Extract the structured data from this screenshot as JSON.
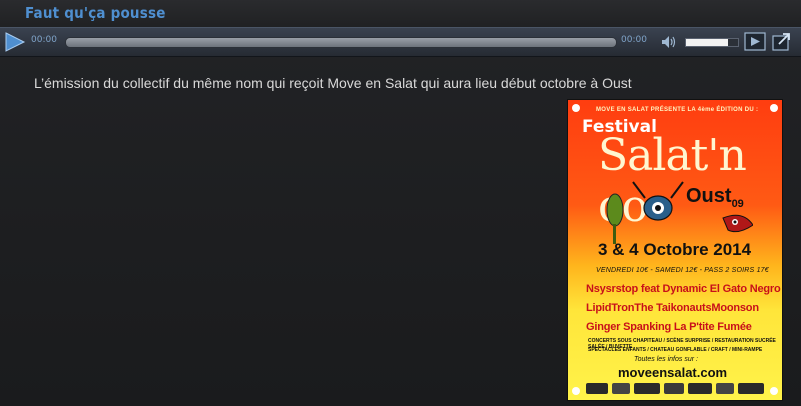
{
  "widget": {
    "title": "Faut qu'ça pousse"
  },
  "player": {
    "current_time": "00:00",
    "duration": "00:00",
    "progress": 0.0,
    "volume": 0.8,
    "icons": {
      "play": "play-icon",
      "volume": "speaker-icon",
      "popup": "popup-player-icon",
      "share": "share-export-icon"
    },
    "accent_color": "#4f8fd0"
  },
  "content": {
    "description": "L’émission du collectif du même nom qui reçoit Move en Salat qui aura lieu début octobre à Oust"
  },
  "poster": {
    "top_line": "MOVE EN SALAT PRÉSENTE LA 4ème ÉDITION DU :",
    "festival": "Festival",
    "name": "Salat'n co",
    "place": "Oust",
    "dept": "09",
    "date": "3 & 4 Octobre 2014",
    "prices": "VENDREDI 10€ - SAMEDI 12€ - PASS 2 SOIRS 17€",
    "line1": "Nsysrstop feat Dynamic El Gato Negro",
    "line2": "LipidTronThe TaikonautsMoonson",
    "line3": "Ginger Spanking  La P'tite Fumée",
    "small1": "CONCERTS SOUS CHAPITEAU / SCÈNE SURPRISE / RESTAURATION SUCRÉE SALÉE / BUVETTE",
    "small2": "SPECTACLES ENFANTS / CHATEAU GONFLABLE / CRAFT / MINI-RAMPE",
    "infos": "Toutes les infos sur :",
    "website": "moveensalat.com"
  }
}
